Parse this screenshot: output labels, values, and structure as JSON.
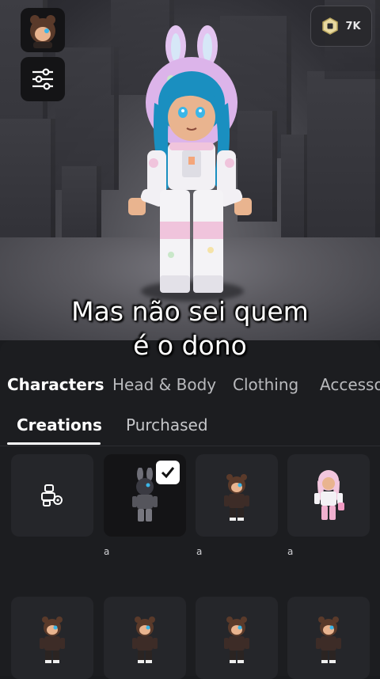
{
  "header": {
    "robux_amount": "7K"
  },
  "caption": {
    "line1": "Mas não sei quem",
    "line2": "é o dono"
  },
  "tabs": [
    {
      "label": "Characters",
      "active": true
    },
    {
      "label": "Head & Body",
      "active": false
    },
    {
      "label": "Clothing",
      "active": false
    },
    {
      "label": "Accesso",
      "active": false
    }
  ],
  "subtabs": [
    {
      "label": "Creations",
      "active": true
    },
    {
      "label": "Purchased",
      "active": false
    }
  ],
  "grid": {
    "row1": [
      {
        "type": "create-character",
        "icon": "character-settings-icon"
      },
      {
        "type": "character",
        "label": "a",
        "selected": true,
        "variant": "bunny-dark"
      },
      {
        "type": "character",
        "label": "a",
        "selected": false,
        "variant": "bear-brown"
      },
      {
        "type": "character",
        "label": "a",
        "selected": false,
        "variant": "pink-girl"
      }
    ],
    "row2": [
      {
        "type": "character",
        "variant": "bear-brown"
      },
      {
        "type": "character",
        "variant": "bear-brown"
      },
      {
        "type": "character",
        "variant": "bear-brown"
      },
      {
        "type": "character",
        "variant": "bear-brown"
      }
    ]
  },
  "colors": {
    "panel": "#1c1d20",
    "card": "#25262a",
    "selected_card": "#141416",
    "accent": "#ffffff"
  }
}
